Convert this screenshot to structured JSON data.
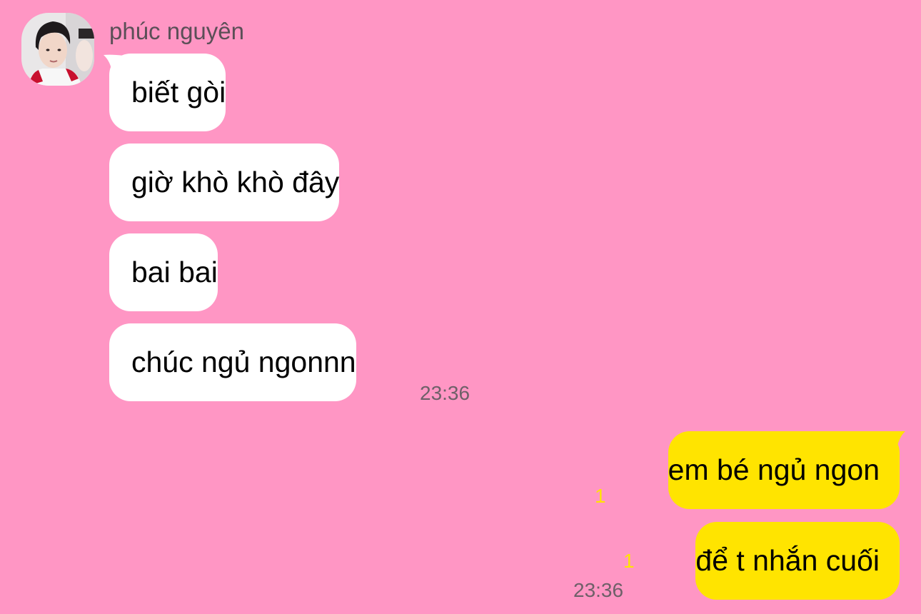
{
  "contact": {
    "name": "phúc nguyên"
  },
  "messages": [
    {
      "from": "them",
      "text": "biết gòi"
    },
    {
      "from": "them",
      "text": "giờ khò khò đây"
    },
    {
      "from": "them",
      "text": "bai bai"
    },
    {
      "from": "them",
      "text": "chúc ngủ ngonnn",
      "time": "23:36"
    },
    {
      "from": "me",
      "text": "em bé ngủ ngon",
      "unread": "1"
    },
    {
      "from": "me",
      "text": "để t nhắn cuối",
      "unread": "1",
      "time": "23:36"
    }
  ],
  "colors": {
    "background": "#FF96C4",
    "incoming_bubble": "#FFFFFF",
    "outgoing_bubble": "#FFE400",
    "unread_count": "#FFE400",
    "timestamp": "#6E6068"
  }
}
